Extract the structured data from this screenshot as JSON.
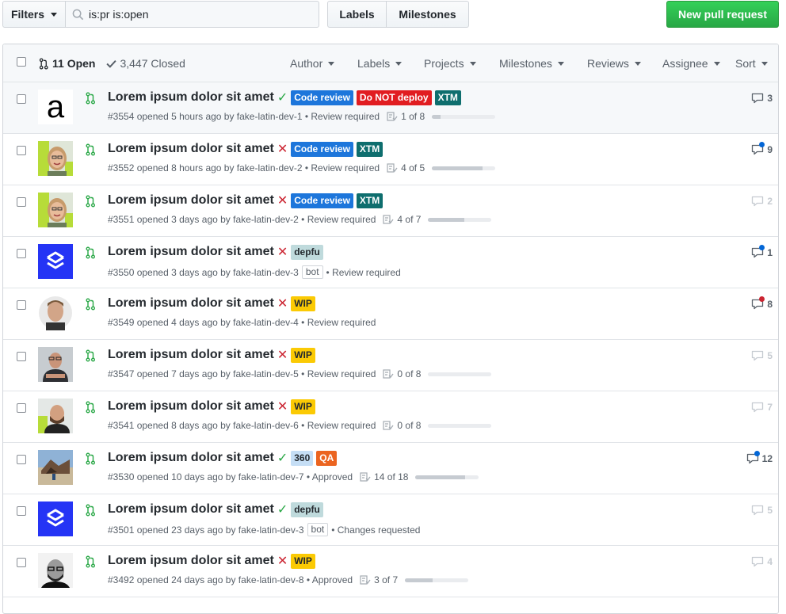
{
  "toolbar": {
    "filters_label": "Filters",
    "search_value": "is:pr is:open",
    "labels_label": "Labels",
    "milestones_label": "Milestones",
    "new_pr_label": "New pull request"
  },
  "header": {
    "open_label": "11 Open",
    "closed_label": "3,447 Closed",
    "filters": {
      "author": "Author",
      "labels": "Labels",
      "projects": "Projects",
      "milestones": "Milestones",
      "reviews": "Reviews",
      "assignee": "Assignee",
      "sort": "Sort"
    }
  },
  "colors": {
    "code_review": "#1d76db",
    "do_not_deploy": "#e11d21",
    "xtm": "#0e6e6e",
    "depfu": "#bfdadc",
    "wip": "#fbca04",
    "three_sixty": "#c5def5",
    "qa": "#eb6420",
    "green": "#28a745",
    "red": "#cb2431",
    "blue_dot": "#0366d6",
    "red_dot": "#cb2431"
  },
  "rows": [
    {
      "title": "Lorem ipsum dolor sit amet",
      "status": "✓",
      "meta": "#3554 opened 5 hours ago by fake-latin-dev-1 • Review required",
      "tasks": "1 of 8",
      "progress": 0.125,
      "comments": "3"
    },
    {
      "title": "Lorem ipsum dolor sit amet",
      "status": "✕",
      "meta": "#3552 opened 8 hours ago by fake-latin-dev-2 • Review required",
      "tasks": "4 of 5",
      "progress": 0.8,
      "comments": "9"
    },
    {
      "title": "Lorem ipsum dolor sit amet",
      "status": "✕",
      "meta": "#3551 opened 3 days ago by fake-latin-dev-2 • Review required",
      "tasks": "4 of 7",
      "progress": 0.57,
      "comments": "2"
    },
    {
      "title": "Lorem ipsum dolor sit amet",
      "status": "✕",
      "meta_before": "#3550 opened 3 days ago by fake-latin-dev-3",
      "bot": "bot",
      "meta_after": "• Review required",
      "comments": "1"
    },
    {
      "title": "Lorem ipsum dolor sit amet",
      "status": "✕",
      "meta": "#3549 opened 4 days ago by fake-latin-dev-4 • Review required",
      "comments": "8"
    },
    {
      "title": "Lorem ipsum dolor sit amet",
      "status": "✕",
      "meta": "#3547 opened 7 days ago by fake-latin-dev-5 • Review required",
      "tasks": "0 of 8",
      "progress": 0,
      "comments": "5"
    },
    {
      "title": "Lorem ipsum dolor sit amet",
      "status": "✕",
      "meta": "#3541 opened 8 days ago by fake-latin-dev-6 • Review required",
      "tasks": "0 of 8",
      "progress": 0,
      "comments": "7"
    },
    {
      "title": "Lorem ipsum dolor sit amet",
      "status": "✓",
      "meta": "#3530 opened 10 days ago by fake-latin-dev-7 • Approved",
      "tasks": "14 of 18",
      "progress": 0.78,
      "comments": "12"
    },
    {
      "title": "Lorem ipsum dolor sit amet",
      "status": "✓",
      "meta_before": "#3501 opened 23 days ago by fake-latin-dev-3",
      "bot": "bot",
      "meta_after": "• Changes requested",
      "comments": "5"
    },
    {
      "title": "Lorem ipsum dolor sit amet",
      "status": "✕",
      "meta": "#3492 opened 24 days ago by fake-latin-dev-8 • Approved",
      "tasks": "3 of 7",
      "progress": 0.43,
      "comments": "4"
    }
  ],
  "labels": {
    "code_review": "Code review",
    "do_not_deploy": "Do NOT deploy",
    "xtm": "XTM",
    "depfu": "depfu",
    "wip": "WIP",
    "three_sixty": "360",
    "qa": "QA"
  },
  "avatars": {
    "a_letter": "a"
  }
}
